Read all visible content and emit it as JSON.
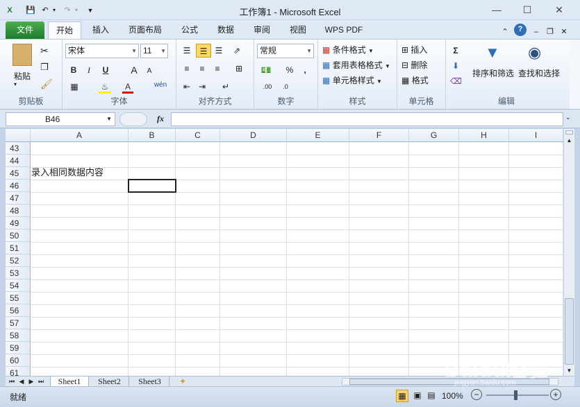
{
  "window": {
    "title": "工作簿1 - Microsoft Excel"
  },
  "tabs": [
    {
      "label": "文件"
    },
    {
      "label": "开始"
    },
    {
      "label": "插入"
    },
    {
      "label": "页面布局"
    },
    {
      "label": "公式"
    },
    {
      "label": "数据"
    },
    {
      "label": "审阅"
    },
    {
      "label": "视图"
    },
    {
      "label": "WPS PDF"
    }
  ],
  "ribbon": {
    "clipboard": {
      "paste": "粘贴",
      "group": "剪贴板"
    },
    "font": {
      "name": "宋体",
      "size": "11",
      "bold": "B",
      "italic": "I",
      "underline": "U",
      "grow": "A",
      "shrink": "A",
      "fontcolor": "A",
      "phonetic": "wén",
      "group": "字体"
    },
    "align": {
      "group": "对齐方式"
    },
    "number": {
      "format": "常规",
      "percent": "%",
      "comma": ",",
      "group": "数字"
    },
    "styles": {
      "cond": "条件格式",
      "table": "套用表格格式",
      "cell": "单元格样式",
      "group": "样式"
    },
    "cells": {
      "insert": "插入",
      "delete": "删除",
      "format": "格式",
      "group": "单元格"
    },
    "editing": {
      "sort": "排序和筛选",
      "find": "查找和选择",
      "group": "编辑"
    }
  },
  "formula": {
    "namebox": "B46",
    "fx": "fx",
    "value": ""
  },
  "columns": [
    "A",
    "B",
    "C",
    "D",
    "E",
    "F",
    "G",
    "H",
    "I"
  ],
  "rows": [
    "43",
    "44",
    "45",
    "46",
    "47",
    "48",
    "49",
    "50",
    "51",
    "52",
    "53",
    "54",
    "55",
    "56",
    "57",
    "58",
    "59",
    "60",
    "61"
  ],
  "cell_text": {
    "A45": "录入相同数据内容"
  },
  "sheets": [
    "Sheet1",
    "Sheet2",
    "Sheet3"
  ],
  "status": {
    "ready": "就绪",
    "zoom": "100%"
  },
  "watermark": {
    "brand": "Baidu经验",
    "url": "jingyan.baidu.com"
  },
  "colors": {
    "file_tab": "#2b8a3e",
    "ribbon_bg": "#e4ecf7",
    "grid_line": "#dadfe6"
  }
}
